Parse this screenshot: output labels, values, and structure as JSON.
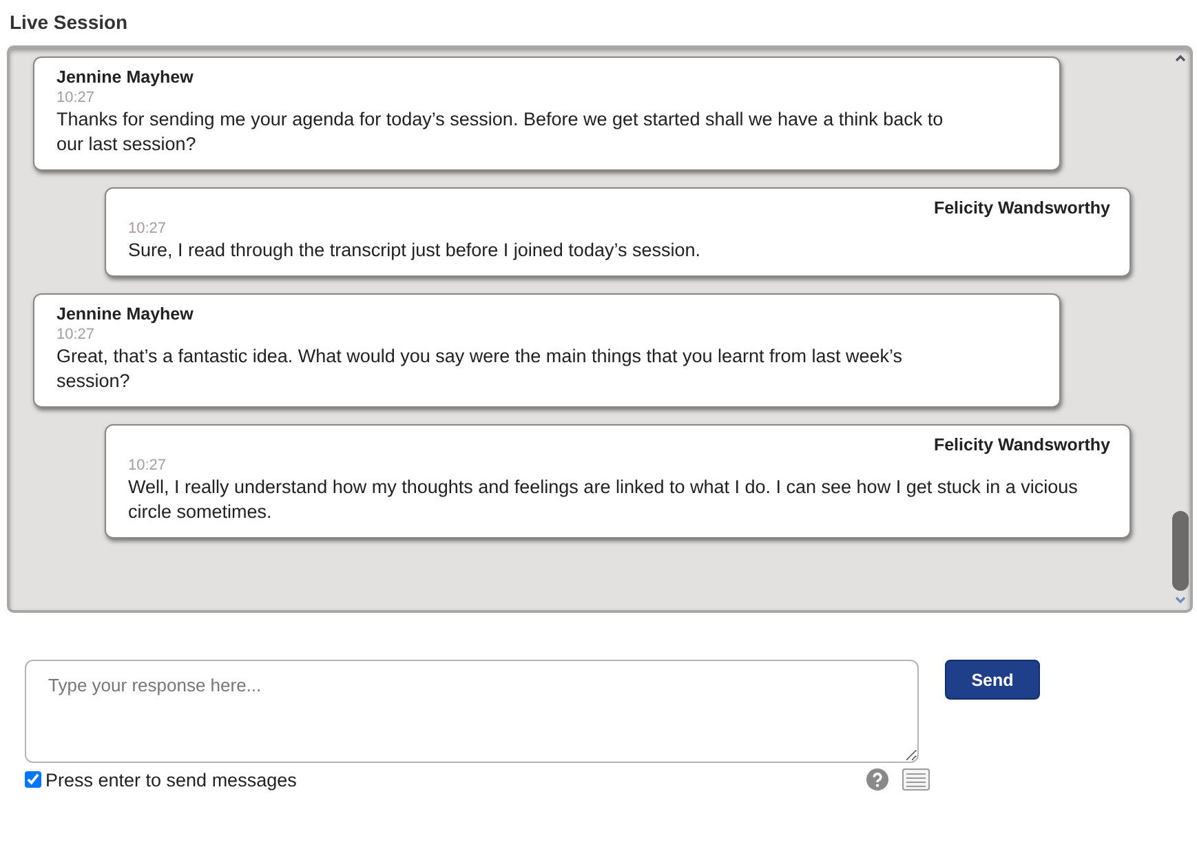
{
  "title": "Live Session",
  "messages": [
    {
      "kind": "left",
      "sender": "Jennine Mayhew",
      "time": "10:27",
      "text": "Thanks for sending me your agenda for today’s session. Before we get started shall we have a think back to our last session?"
    },
    {
      "kind": "right",
      "sender": "Felicity Wandsworthy",
      "time": "10:27",
      "text": "Sure, I read through the transcript just before I joined today’s session."
    },
    {
      "kind": "left",
      "sender": "Jennine Mayhew",
      "time": "10:27",
      "text": "Great, that’s a fantastic idea. What would you say were the main things that you learnt from last week’s session?"
    },
    {
      "kind": "right",
      "sender": "Felicity Wandsworthy",
      "time": "10:27",
      "text": "Well, I really understand how my thoughts and feelings are linked to what I do. I can see how I get stuck in a vicious circle sometimes."
    }
  ],
  "response": {
    "placeholder": "Type your response here..."
  },
  "send_button": "Send",
  "enter_to_send": {
    "label": "Press enter to send messages",
    "checked": true
  }
}
